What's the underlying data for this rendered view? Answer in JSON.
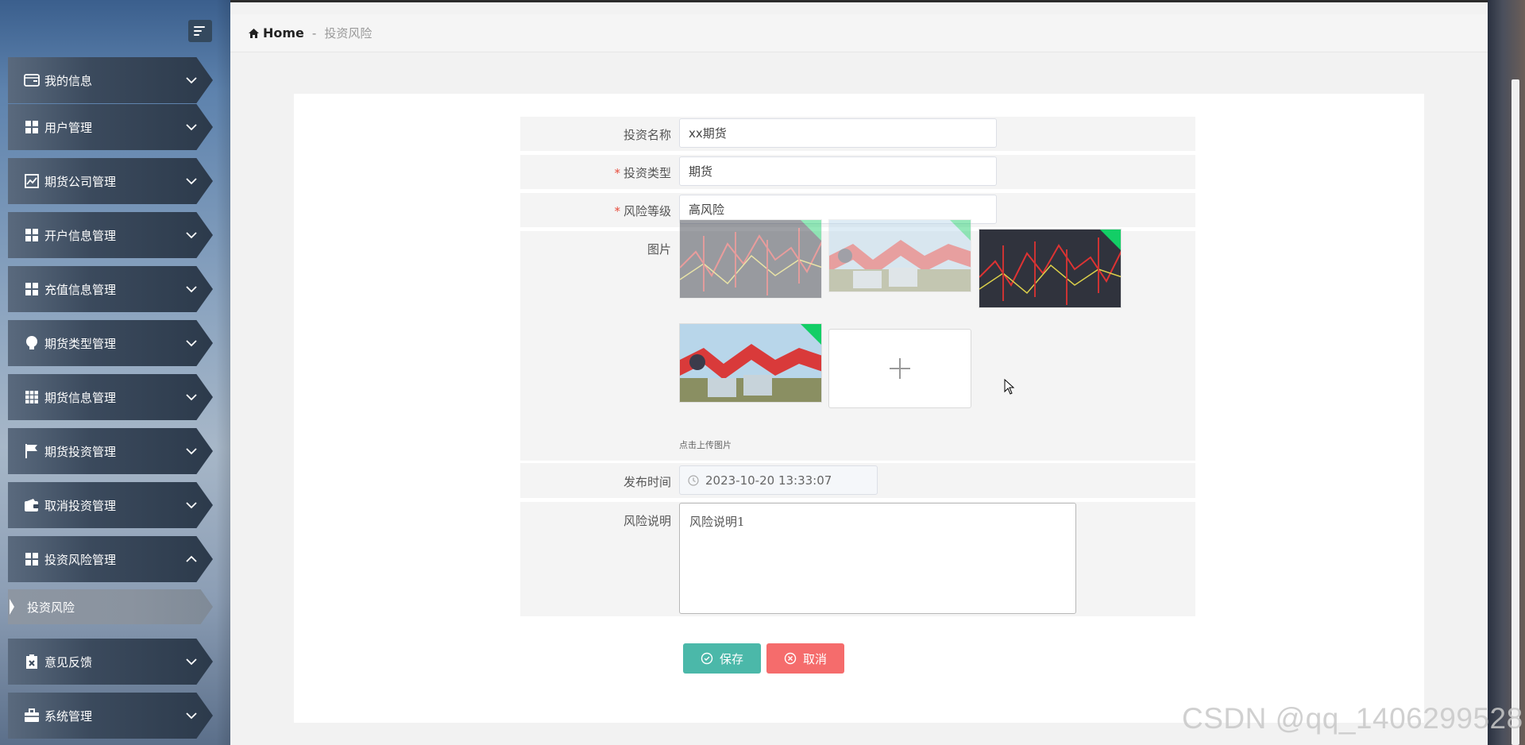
{
  "sidebar": {
    "items": [
      {
        "label": "我的信息",
        "icon": "id-card-icon"
      },
      {
        "label": "用户管理",
        "icon": "grid-icon"
      },
      {
        "label": "期货公司管理",
        "icon": "chart-icon"
      },
      {
        "label": "开户信息管理",
        "icon": "grid-icon"
      },
      {
        "label": "充值信息管理",
        "icon": "grid-icon"
      },
      {
        "label": "期货类型管理",
        "icon": "lightbulb-icon"
      },
      {
        "label": "期货信息管理",
        "icon": "table-icon"
      },
      {
        "label": "期货投资管理",
        "icon": "flag-icon"
      },
      {
        "label": "取消投资管理",
        "icon": "wallet-icon"
      },
      {
        "label": "投资风险管理",
        "icon": "grid-icon"
      },
      {
        "label": "意见反馈",
        "icon": "clipboard-icon"
      },
      {
        "label": "系统管理",
        "icon": "briefcase-icon"
      }
    ],
    "active_sub_item": "投资风险"
  },
  "breadcrumb": {
    "home": "Home",
    "separator": "-",
    "current": "投资风险"
  },
  "form": {
    "name_label": "投资名称",
    "name_value": "xx期货",
    "type_label": "投资类型",
    "type_value": "期货",
    "risk_label": "风险等级",
    "risk_value": "高风险",
    "images_label": "图片",
    "upload_tip": "点击上传图片",
    "publish_label": "发布时间",
    "publish_value": "2023-10-20 13:33:07",
    "desc_label": "风险说明",
    "desc_value": "风险说明1",
    "save_label": "保存",
    "cancel_label": "取消"
  },
  "watermark": "CSDN @qq_1406299528",
  "colors": {
    "save": "#4bb8a9",
    "cancel": "#f56c6c",
    "success_corner": "#13ce66",
    "required": "#e74c3c"
  }
}
